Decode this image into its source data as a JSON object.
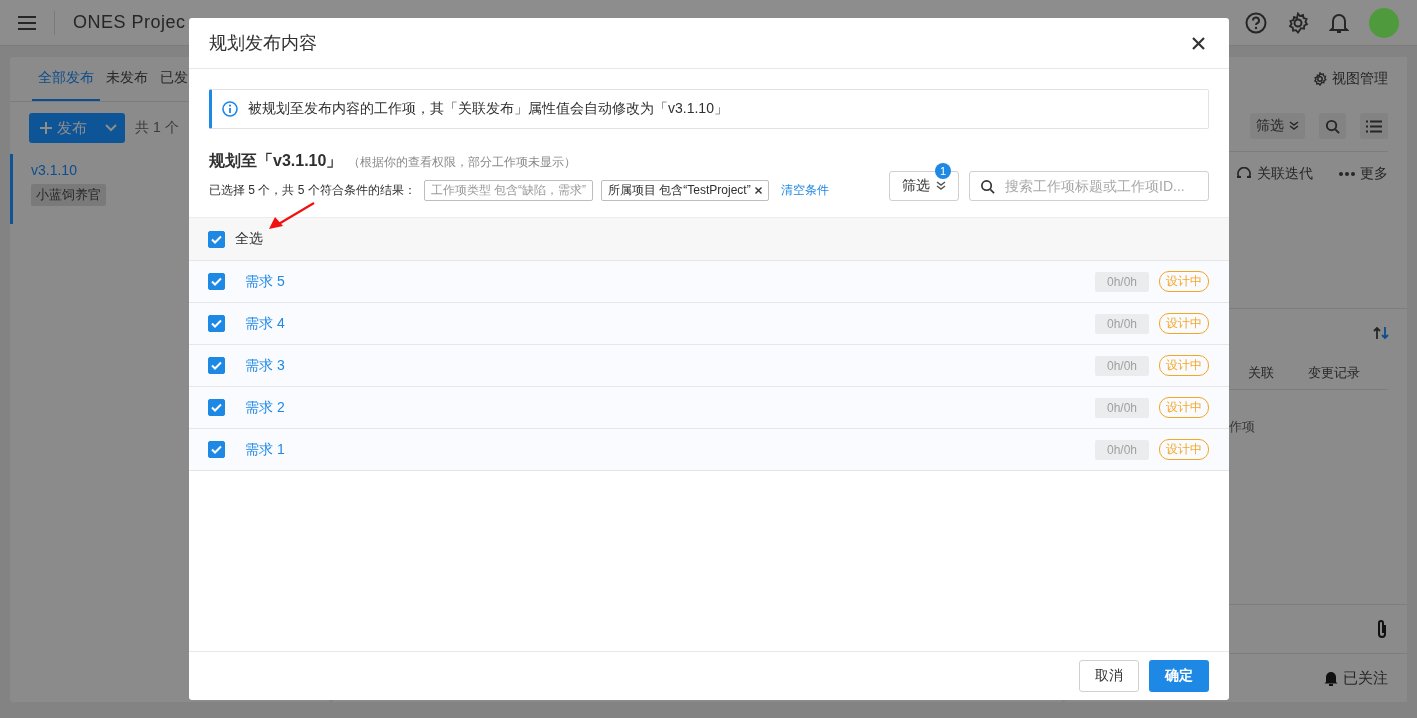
{
  "top_bar": {
    "title": "ONES Projec"
  },
  "releases_panel": {
    "tabs": [
      {
        "label": "全部发布",
        "selected": true
      },
      {
        "label": "未发布",
        "selected": false
      },
      {
        "label": "已发",
        "selected": false
      }
    ],
    "new_button": "发布",
    "count": "共 1 个",
    "items": [
      {
        "version": "v3.1.10",
        "tag": "小蓝饲养官",
        "selected": true
      }
    ]
  },
  "detail_panel": {
    "view_manage": "视图管理",
    "filter": "筛选",
    "link_iteration": "关联迭代",
    "more": "更多",
    "tabs": [
      {
        "label": "关联"
      },
      {
        "label": "变更记录"
      }
    ],
    "partial_text": "作项",
    "follow": "已关注"
  },
  "dialog": {
    "title": "规划发布内容",
    "notice": "被规划至发布内容的工作项，其「关联发布」属性值会自动修改为「v3.1.10」",
    "plan_title": "规划至「v3.1.10」",
    "plan_note": "（根据你的查看权限，部分工作项未显示）",
    "summary": "已选择 5 个，共 5 个符合条件的结果：",
    "conditions": [
      {
        "text": "工作项类型 包含“缺陷，需求”",
        "removable": false
      },
      {
        "text": "所属项目 包含“TestProject”",
        "removable": true
      }
    ],
    "clear": "清空条件",
    "filter_button": {
      "label": "筛选",
      "badge": "1"
    },
    "search": {
      "placeholder": "搜索工作项标题或工作项ID..."
    },
    "select_all": {
      "label": "全选",
      "checked": true
    },
    "rows": [
      {
        "title": "需求 5",
        "checked": true,
        "hours": "0h/0h",
        "status": "设计中"
      },
      {
        "title": "需求 4",
        "checked": true,
        "hours": "0h/0h",
        "status": "设计中"
      },
      {
        "title": "需求 3",
        "checked": true,
        "hours": "0h/0h",
        "status": "设计中"
      },
      {
        "title": "需求 2",
        "checked": true,
        "hours": "0h/0h",
        "status": "设计中"
      },
      {
        "title": "需求 1",
        "checked": true,
        "hours": "0h/0h",
        "status": "设计中"
      }
    ],
    "cancel": "取消",
    "ok": "确定"
  }
}
